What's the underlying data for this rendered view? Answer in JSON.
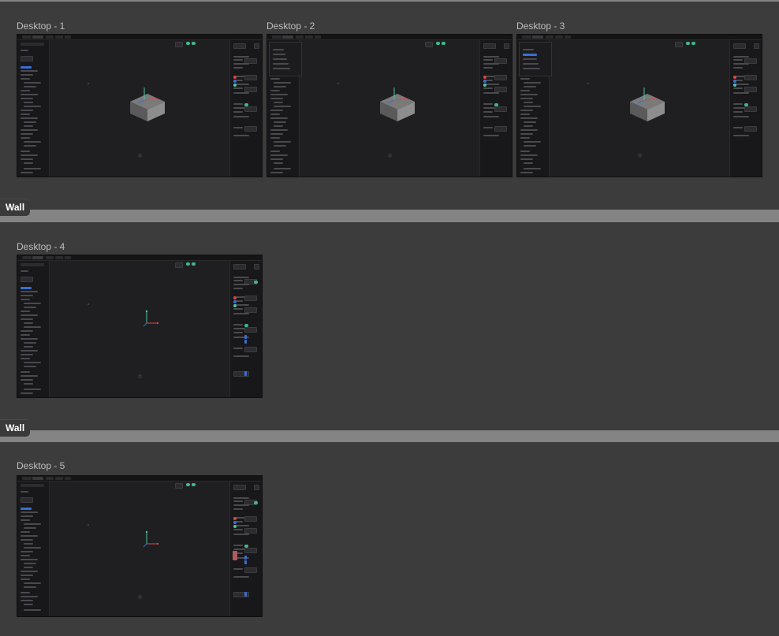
{
  "sections": [
    {
      "tag": "Wall"
    },
    {
      "tag": "Wall"
    },
    {
      "tag": ""
    }
  ],
  "frames": [
    {
      "label": "Desktop - 1",
      "variant": "cube"
    },
    {
      "label": "Desktop - 2",
      "variant": "cube-dropdown"
    },
    {
      "label": "Desktop - 3",
      "variant": "cube-dropdown-selected"
    },
    {
      "label": "Desktop - 4",
      "variant": "axes"
    },
    {
      "label": "Desktop - 5",
      "variant": "axes-swatch"
    }
  ],
  "colors": {
    "canvas_bg": "#3c3c3c",
    "separator": "#848484",
    "app_bg": "#1f1f21",
    "panel_bg": "#18181a",
    "accent_blue": "#3a6fd0",
    "accent_green": "#3fb98a",
    "axis_x": "#e0443e",
    "axis_y": "#4fc3a0",
    "axis_z": "#3a6fd0",
    "cube_top": "#7a7a7a",
    "cube_left": "#5a5a5a",
    "cube_right": "#8d8d8d"
  }
}
